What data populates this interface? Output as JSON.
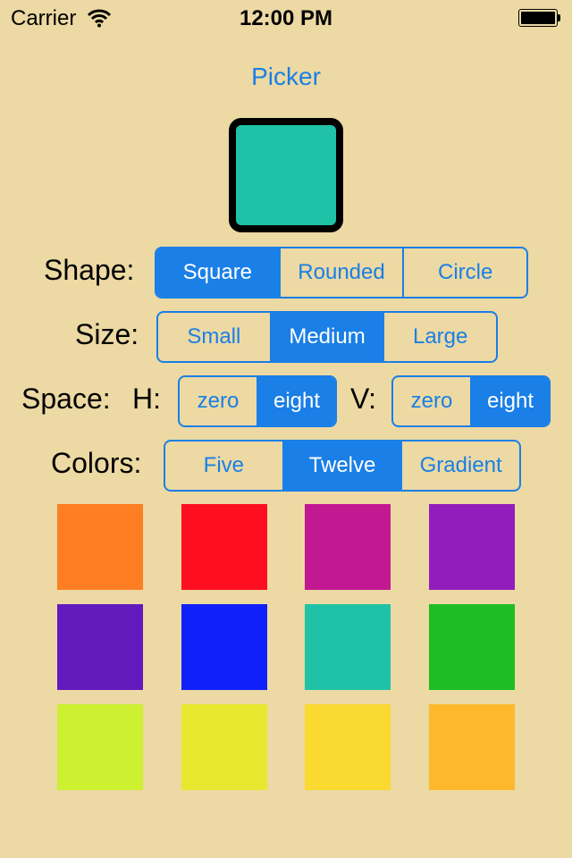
{
  "status_bar": {
    "carrier": "Carrier",
    "time": "12:00 PM"
  },
  "title": "Picker",
  "preview": {
    "color": "#20c2a7"
  },
  "shape": {
    "label": "Shape:",
    "options": [
      "Square",
      "Rounded",
      "Circle"
    ],
    "selected": 0
  },
  "size": {
    "label": "Size:",
    "options": [
      "Small",
      "Medium",
      "Large"
    ],
    "selected": 1
  },
  "space": {
    "label": "Space:",
    "h_label": "H:",
    "h_options": [
      "zero",
      "eight"
    ],
    "h_selected": 1,
    "v_label": "V:",
    "v_options": [
      "zero",
      "eight"
    ],
    "v_selected": 1
  },
  "colors": {
    "label": "Colors:",
    "options": [
      "Five",
      "Twelve",
      "Gradient"
    ],
    "selected": 1
  },
  "swatches": [
    "#fe7e24",
    "#fe0f1f",
    "#c21891",
    "#921dbc",
    "#631abd",
    "#1020fb",
    "#20c2a7",
    "#1fbd25",
    "#cdf030",
    "#e8e831",
    "#fad930",
    "#fdb92b"
  ],
  "accent_color": "#1a7fe6"
}
